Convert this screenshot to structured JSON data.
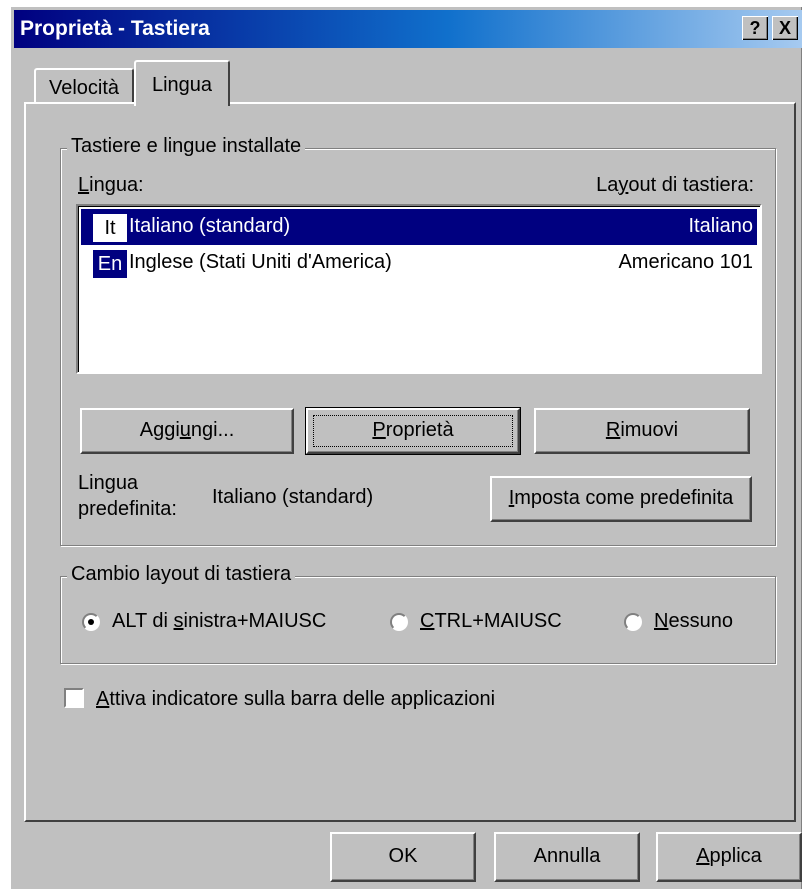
{
  "window": {
    "title": "Proprietà - Tastiera",
    "help_btn": "?",
    "close_btn": "X"
  },
  "tabs": [
    {
      "label": "Velocità",
      "active": false
    },
    {
      "label": "Lingua",
      "active": true
    }
  ],
  "installed": {
    "group_label": "Tastiere e lingue installate",
    "col_language": {
      "pre": "",
      "u": "L",
      "post": "ingua:"
    },
    "col_layout": {
      "pre": "La",
      "u": "y",
      "post": "out di tastiera:"
    },
    "rows": [
      {
        "badge": "It",
        "language": "Italiano (standard)",
        "layout": "Italiano",
        "selected": true
      },
      {
        "badge": "En",
        "language": "Inglese (Stati Uniti d'America)",
        "layout": "Americano 101",
        "selected": false
      }
    ]
  },
  "buttons": {
    "add": {
      "pre": "Aggi",
      "u": "u",
      "post": "ngi..."
    },
    "properties": {
      "pre": "",
      "u": "P",
      "post": "roprietà"
    },
    "remove": {
      "pre": "",
      "u": "R",
      "post": "imuovi"
    },
    "set_default": {
      "pre": "",
      "u": "I",
      "post": "mposta come predefinita"
    }
  },
  "default_language": {
    "label_line1": "Lingua",
    "label_line2": "predefinita:",
    "value": "Italiano (standard)"
  },
  "switch_layout": {
    "group_label": "Cambio layout di tastiera",
    "options": [
      {
        "pre": "ALT di ",
        "u": "s",
        "post": "inistra+MAIUSC",
        "checked": true
      },
      {
        "pre": "",
        "u": "C",
        "post": "TRL+MAIUSC",
        "checked": false
      },
      {
        "pre": "",
        "u": "N",
        "post": "essuno",
        "checked": false
      }
    ]
  },
  "indicator": {
    "pre": "",
    "u": "A",
    "post": "ttiva indicatore sulla barra delle applicazioni",
    "checked": false
  },
  "footer": {
    "ok": "OK",
    "cancel": "Annulla",
    "apply": {
      "pre": "",
      "u": "A",
      "post": "pplica"
    }
  },
  "colors": {
    "face": "#c0c0c0",
    "title_start": "#000080",
    "title_end": "#a6caf0",
    "selection": "#000080"
  }
}
